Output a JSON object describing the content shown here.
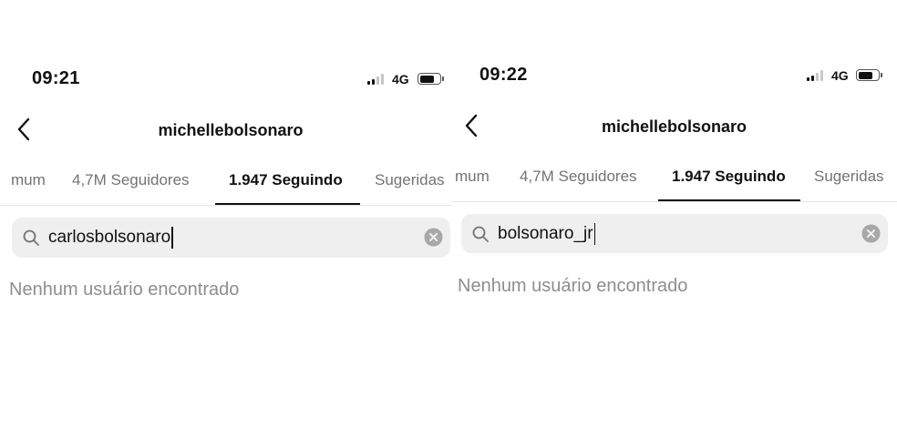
{
  "screens": [
    {
      "status": {
        "time": "09:21",
        "network": "4G",
        "signal_bars_active": 2,
        "signal_bars_total": 4,
        "battery_level": 0.75
      },
      "header": {
        "title": "michellebolsonaro"
      },
      "tabs": [
        {
          "label": "mum",
          "active": false
        },
        {
          "label": "4,7M Seguidores",
          "active": false
        },
        {
          "label": "1.947 Seguindo",
          "active": true
        },
        {
          "label": "Sugeridas",
          "active": false
        }
      ],
      "search": {
        "value": "carlosbolsonaro"
      },
      "empty_message": "Nenhum usuário encontrado"
    },
    {
      "status": {
        "time": "09:22",
        "network": "4G",
        "signal_bars_active": 2,
        "signal_bars_total": 4,
        "battery_level": 0.75
      },
      "header": {
        "title": "michellebolsonaro"
      },
      "tabs": [
        {
          "label": "mum",
          "active": false
        },
        {
          "label": "4,7M Seguidores",
          "active": false
        },
        {
          "label": "1.947 Seguindo",
          "active": true
        },
        {
          "label": "Sugeridas",
          "active": false
        }
      ],
      "search": {
        "value": "bolsonaro_jr"
      },
      "empty_message": "Nenhum usuário encontrado"
    }
  ],
  "icons": {
    "back": "chevron-left-icon",
    "search": "search-icon",
    "clear": "clear-circle-x-icon",
    "signal": "cellular-signal-icon",
    "battery": "battery-icon"
  },
  "colors": {
    "text_primary": "#111111",
    "text_secondary": "#737373",
    "empty_text": "#8e8e8e",
    "search_bg": "#efefef",
    "clear_icon_bg": "#a8a8a8"
  }
}
